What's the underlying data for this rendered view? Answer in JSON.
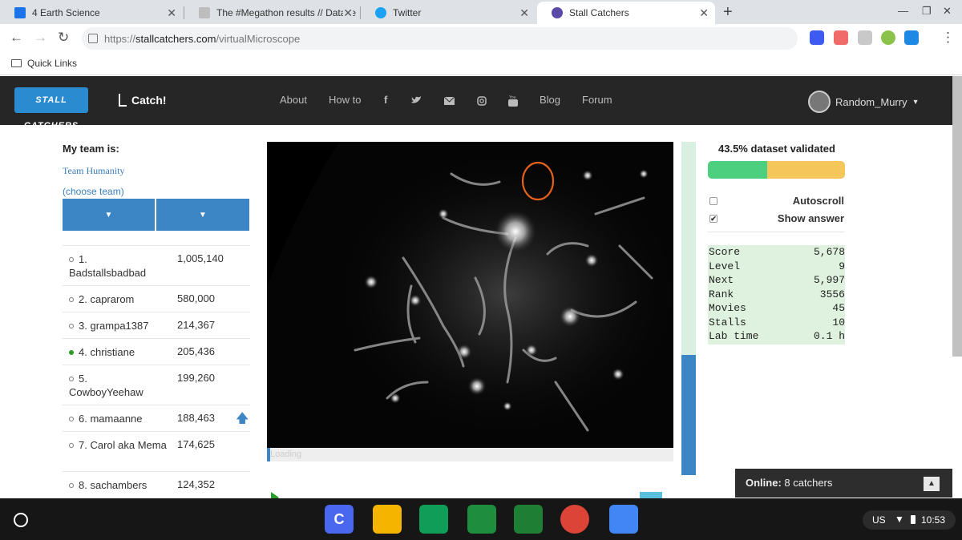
{
  "browser": {
    "tabs": [
      {
        "title": "4 Earth Science",
        "icon_color": "#1a73e8"
      },
      {
        "title": "The #Megathon results // Datase",
        "icon_color": "#9e9e9e"
      },
      {
        "title": "Twitter",
        "icon_color": "#1da1f2"
      },
      {
        "title": "Stall Catchers",
        "icon_color": "#5b4aa8"
      }
    ],
    "url_scheme": "https://",
    "url_host": "stallcatchers.com",
    "url_path": "/virtualMicroscope",
    "bookmark": "Quick Links"
  },
  "site": {
    "logo": "STALL CATCHERS",
    "catch_label": "Catch!",
    "nav": [
      "About",
      "How to",
      "Blog",
      "Forum"
    ],
    "nav_icons": [
      "facebook-icon",
      "twitter-icon",
      "mail-icon",
      "instagram-icon",
      "youtube-icon"
    ],
    "username": "Random_Murry"
  },
  "team": {
    "heading": "My team is:",
    "name": "Team Humanity",
    "choose": "(choose team)"
  },
  "leaderboard": [
    {
      "rank": "1.",
      "name": "Badstallsbadbad",
      "score": "1,005,140",
      "me": false,
      "up": false
    },
    {
      "rank": "2.",
      "name": "caprarom",
      "score": "580,000",
      "me": false,
      "up": false
    },
    {
      "rank": "3.",
      "name": "grampa1387",
      "score": "214,367",
      "me": false,
      "up": false
    },
    {
      "rank": "4.",
      "name": "christiane",
      "score": "205,436",
      "me": true,
      "up": false
    },
    {
      "rank": "5.",
      "name": "CowboyYeehaw",
      "score": "199,260",
      "me": false,
      "up": false
    },
    {
      "rank": "6.",
      "name": "mamaanne",
      "score": "188,463",
      "me": false,
      "up": true
    },
    {
      "rank": "7.",
      "name": "Carol aka Mema",
      "score": "174,625",
      "me": false,
      "up": false
    },
    {
      "rank": "8.",
      "name": "sachambers",
      "score": "124,352",
      "me": false,
      "up": false
    }
  ],
  "viewer": {
    "loading_label": "Loading",
    "vessel_progress_fraction": 0.36
  },
  "stats": {
    "validated": "43.5% dataset validated",
    "validated_fraction": 0.435,
    "autoscroll": "Autoscroll",
    "autoscroll_checked": false,
    "show_answer": "Show answer",
    "show_answer_checked": true,
    "rows": [
      {
        "k": "Score",
        "v": "5,678"
      },
      {
        "k": "Level",
        "v": "9"
      },
      {
        "k": "Next",
        "v": "5,997"
      },
      {
        "k": "Rank",
        "v": "3556"
      },
      {
        "k": "Movies",
        "v": "45"
      },
      {
        "k": "Stalls",
        "v": "10"
      },
      {
        "k": "Lab time",
        "v": "0.1 h"
      }
    ]
  },
  "online": {
    "label": "Online:",
    "value": "8 catchers"
  },
  "shelf": {
    "apps": [
      {
        "name": "canva-app-icon",
        "color": "#4a67f0",
        "glyph": "C"
      },
      {
        "name": "slides-app-icon",
        "color": "#f4b400",
        "glyph": ""
      },
      {
        "name": "sheets-app-icon",
        "color": "#0f9d58",
        "glyph": ""
      },
      {
        "name": "drive-app-icon",
        "color": "#1e8e3e",
        "glyph": ""
      },
      {
        "name": "classroom-app-icon",
        "color": "#1e7e34",
        "glyph": ""
      },
      {
        "name": "chrome-app-icon",
        "color": "#db4437",
        "glyph": ""
      },
      {
        "name": "docs-app-icon",
        "color": "#4285f4",
        "glyph": ""
      }
    ],
    "locale": "US",
    "time": "10:53"
  }
}
